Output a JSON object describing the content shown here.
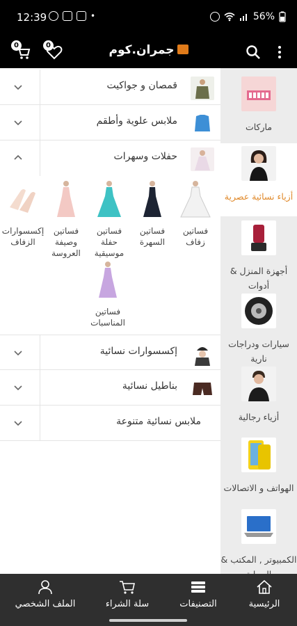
{
  "status_bar": {
    "time": "12:39",
    "battery": "56%"
  },
  "header": {
    "logo_text": "جمران.كوم",
    "cart_count": "0",
    "wishlist_count": "0"
  },
  "sidebar": {
    "items": [
      {
        "label": "ماركات",
        "active": false
      },
      {
        "label": "أزياء نسائية عصرية",
        "active": true
      },
      {
        "label": "أجهزة المنزل & أدوات",
        "active": false
      },
      {
        "label": "سيارات ودراجات نارية",
        "active": false
      },
      {
        "label": "أزياء رجالية",
        "active": false
      },
      {
        "label": "الهواتف و الاتصالات",
        "active": false
      },
      {
        "label": "الكمبيوتر , المكتب & الحماية",
        "active": false
      }
    ]
  },
  "main": {
    "rows": [
      {
        "label": "قمصان و جواكيت",
        "expanded": false
      },
      {
        "label": "ملابس علوية وأطقم",
        "expanded": false
      },
      {
        "label": "حفلات وسهرات",
        "expanded": true
      },
      {
        "label": "إكسسوارات نسائية",
        "expanded": false
      },
      {
        "label": "بناطيل نسائية",
        "expanded": false
      },
      {
        "label": "ملابس نسائية متنوعة",
        "expanded": false
      }
    ],
    "subcategories": [
      {
        "label": "فساتين زفاف"
      },
      {
        "label": "فساتين السهرة"
      },
      {
        "label": "فساتين حفلة موسيقية"
      },
      {
        "label": "فساتين وصيفة العروسة"
      },
      {
        "label": "إكسسوارات الزفاف"
      },
      {
        "label": "فساتين المناسبات"
      }
    ]
  },
  "bottom_nav": {
    "home": "الرئيسية",
    "categories": "التصنيفات",
    "cart": "سلة الشراء",
    "profile": "الملف الشخصي"
  },
  "colors": {
    "accent": "#e0892a",
    "header_bg": "#000000",
    "nav_bg": "#2f2f2f"
  }
}
